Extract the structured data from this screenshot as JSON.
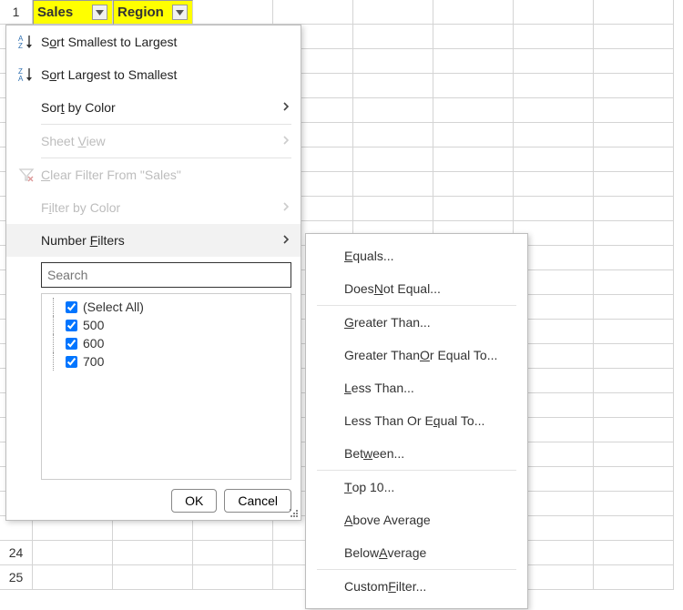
{
  "headers": {
    "sales": "Sales",
    "region": "Region"
  },
  "visible_row_numbers": [
    "1",
    "24",
    "25"
  ],
  "dropdown": {
    "sort_asc": "Sort Smallest to Largest",
    "sort_desc": "Sort Largest to Smallest",
    "sort_color": "Sort by Color",
    "sheet_view": "Sheet View",
    "clear_filter": "Clear Filter From \"Sales\"",
    "filter_color": "Filter by Color",
    "number_filters": "Number Filters",
    "search_placeholder": "Search",
    "values": {
      "select_all": "(Select All)",
      "items": [
        "500",
        "600",
        "700"
      ]
    },
    "ok": "OK",
    "cancel": "Cancel"
  },
  "number_filters_submenu": {
    "equals": "Equals...",
    "not_equal": "Does Not Equal...",
    "greater": "Greater Than...",
    "greater_eq": "Greater Than Or Equal To...",
    "less": "Less Than...",
    "less_eq": "Less Than Or Equal To...",
    "between": "Between...",
    "top10": "Top 10...",
    "above_avg": "Above Average",
    "below_avg": "Below Average",
    "custom": "Custom Filter..."
  }
}
